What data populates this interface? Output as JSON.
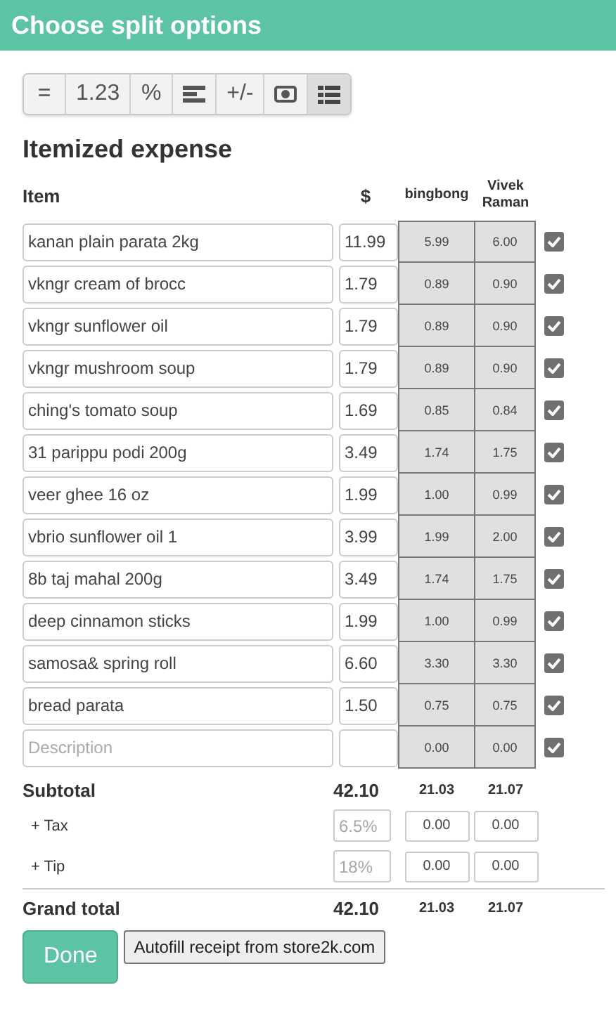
{
  "header": {
    "title": "Choose split options"
  },
  "toolbar": [
    {
      "kind": "text",
      "label": "=",
      "selected": false
    },
    {
      "kind": "text",
      "label": "1.23",
      "selected": false
    },
    {
      "kind": "text",
      "label": "%",
      "selected": false
    },
    {
      "kind": "bars",
      "selected": false
    },
    {
      "kind": "text",
      "label": "+/-",
      "selected": false
    },
    {
      "kind": "bill",
      "selected": false
    },
    {
      "kind": "list",
      "selected": true
    }
  ],
  "section_title": "Itemized expense",
  "columns": {
    "item": "Item",
    "price": "$",
    "people": [
      "bingbong",
      "Vivek Raman"
    ]
  },
  "rows": [
    {
      "description": "kanan plain parata 2kg",
      "price": "11.99",
      "shares": [
        "5.99",
        "6.00"
      ],
      "checked": true
    },
    {
      "description": "vkngr cream of brocc",
      "price": "1.79",
      "shares": [
        "0.89",
        "0.90"
      ],
      "checked": true
    },
    {
      "description": "vkngr sunflower oil",
      "price": "1.79",
      "shares": [
        "0.89",
        "0.90"
      ],
      "checked": true
    },
    {
      "description": "vkngr mushroom soup",
      "price": "1.79",
      "shares": [
        "0.89",
        "0.90"
      ],
      "checked": true
    },
    {
      "description": "ching's tomato soup",
      "price": "1.69",
      "shares": [
        "0.85",
        "0.84"
      ],
      "checked": true
    },
    {
      "description": "31 parippu podi 200g",
      "price": "3.49",
      "shares": [
        "1.74",
        "1.75"
      ],
      "checked": true
    },
    {
      "description": "veer ghee 16 oz",
      "price": "1.99",
      "shares": [
        "1.00",
        "0.99"
      ],
      "checked": true
    },
    {
      "description": "vbrio sunflower oil 1",
      "price": "3.99",
      "shares": [
        "1.99",
        "2.00"
      ],
      "checked": true
    },
    {
      "description": "8b taj mahal 200g",
      "price": "3.49",
      "shares": [
        "1.74",
        "1.75"
      ],
      "checked": true
    },
    {
      "description": "deep cinnamon sticks",
      "price": "1.99",
      "shares": [
        "1.00",
        "0.99"
      ],
      "checked": true
    },
    {
      "description": "samosa& spring roll",
      "price": "6.60",
      "shares": [
        "3.30",
        "3.30"
      ],
      "checked": true
    },
    {
      "description": "bread parata",
      "price": "1.50",
      "shares": [
        "0.75",
        "0.75"
      ],
      "checked": true
    },
    {
      "placeholder": "Description",
      "shares": [
        "0.00",
        "0.00"
      ],
      "checked": true
    }
  ],
  "subtotal": {
    "label": "Subtotal",
    "amount": "42.10",
    "shares": [
      "21.03",
      "21.07"
    ]
  },
  "adjustments": [
    {
      "label": "+ Tax",
      "placeholder": "6.5%",
      "shares": [
        "0.00",
        "0.00"
      ]
    },
    {
      "label": "+ Tip",
      "placeholder": "18%",
      "shares": [
        "0.00",
        "0.00"
      ]
    }
  ],
  "grand_total": {
    "label": "Grand total",
    "amount": "42.10",
    "shares": [
      "21.03",
      "21.07"
    ]
  },
  "buttons": {
    "done": "Done",
    "autofill": "Autofill receipt from store2k.com"
  }
}
